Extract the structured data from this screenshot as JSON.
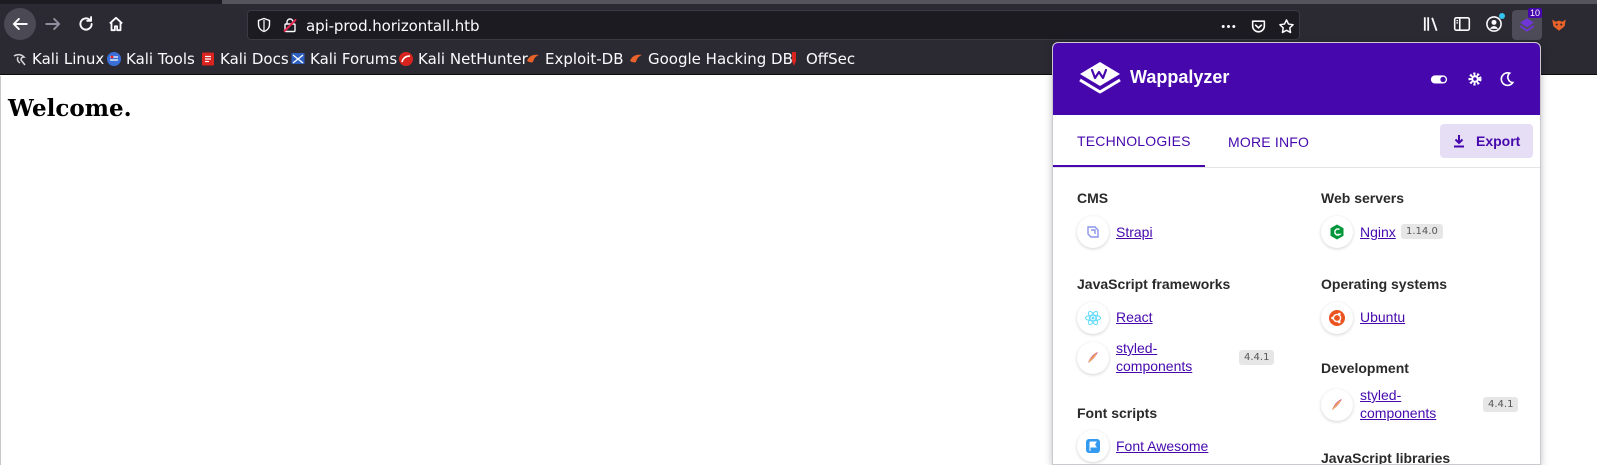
{
  "browser": {
    "url": "api-prod.horizontall.htb",
    "bookmarks": [
      {
        "label": "Kali Linux"
      },
      {
        "label": "Kali Tools"
      },
      {
        "label": "Kali Docs"
      },
      {
        "label": "Kali Forums"
      },
      {
        "label": "Kali NetHunter"
      },
      {
        "label": "Exploit-DB"
      },
      {
        "label": "Google Hacking DB"
      },
      {
        "label": "OffSec"
      }
    ],
    "extension_badge": "10"
  },
  "page": {
    "heading": "Welcome."
  },
  "wappalyzer": {
    "title": "Wappalyzer",
    "tabs": {
      "technologies": "TECHNOLOGIES",
      "more_info": "MORE INFO"
    },
    "export_label": "Export",
    "left_column": [
      {
        "category": "CMS",
        "items": [
          {
            "name": "Strapi",
            "version": ""
          }
        ]
      },
      {
        "category": "JavaScript frameworks",
        "items": [
          {
            "name": "React",
            "version": ""
          },
          {
            "name_line1": "styled-",
            "name_line2": "components",
            "version": "4.4.1"
          }
        ]
      },
      {
        "category": "Font scripts",
        "items": [
          {
            "name": "Font Awesome",
            "version": ""
          }
        ]
      }
    ],
    "right_column": [
      {
        "category": "Web servers",
        "items": [
          {
            "name": "Nginx",
            "version": "1.14.0"
          }
        ]
      },
      {
        "category": "Operating systems",
        "items": [
          {
            "name": "Ubuntu",
            "version": ""
          }
        ]
      },
      {
        "category": "Development",
        "items": [
          {
            "name_line1": "styled-",
            "name_line2": "components",
            "version": "4.4.1"
          }
        ]
      },
      {
        "category": "JavaScript libraries",
        "items": []
      }
    ]
  },
  "colors": {
    "wappalyzer_purple": "#4608ad",
    "toolbar_bg": "#2b2a33",
    "urlbar_bg": "#1c1b22"
  }
}
